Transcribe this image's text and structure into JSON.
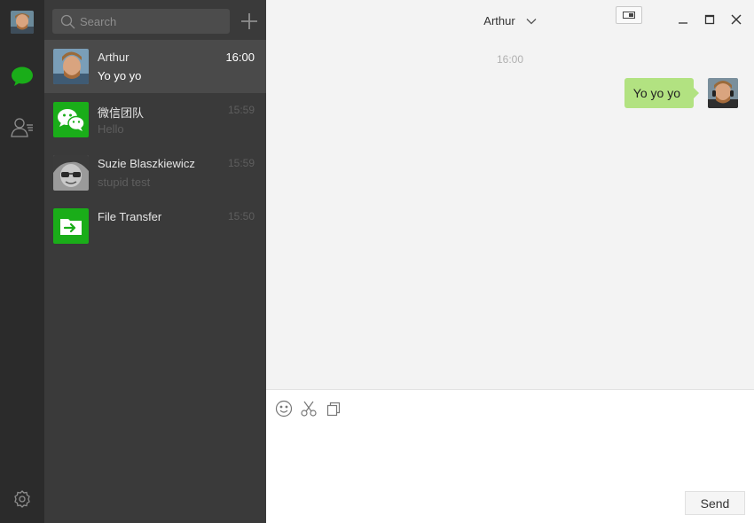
{
  "sidebar": {
    "profile_avatar_icon": "profile-avatar",
    "chat_icon": "chat-bubble-icon",
    "contacts_icon": "contacts-icon",
    "settings_icon": "gear-icon",
    "accent": "#1aad19"
  },
  "search": {
    "placeholder": "Search"
  },
  "conversations": [
    {
      "name": "Arthur",
      "time": "16:00",
      "last_message": "Yo yo yo",
      "active": true
    },
    {
      "name": "微信团队",
      "time": "15:59",
      "last_message": "Hello",
      "active": false
    },
    {
      "name": "Suzie Blaszkiewicz",
      "time": "15:59",
      "last_message": "stupid test",
      "active": false
    },
    {
      "name": "File Transfer",
      "time": "15:50",
      "last_message": "",
      "active": false
    }
  ],
  "chat": {
    "title": "Arthur",
    "timestamp": "16:00",
    "messages": [
      {
        "text": "Yo yo yo",
        "from_self": true
      }
    ],
    "bubble_color": "#b2e281"
  },
  "input": {
    "value": "",
    "send_label": "Send"
  }
}
